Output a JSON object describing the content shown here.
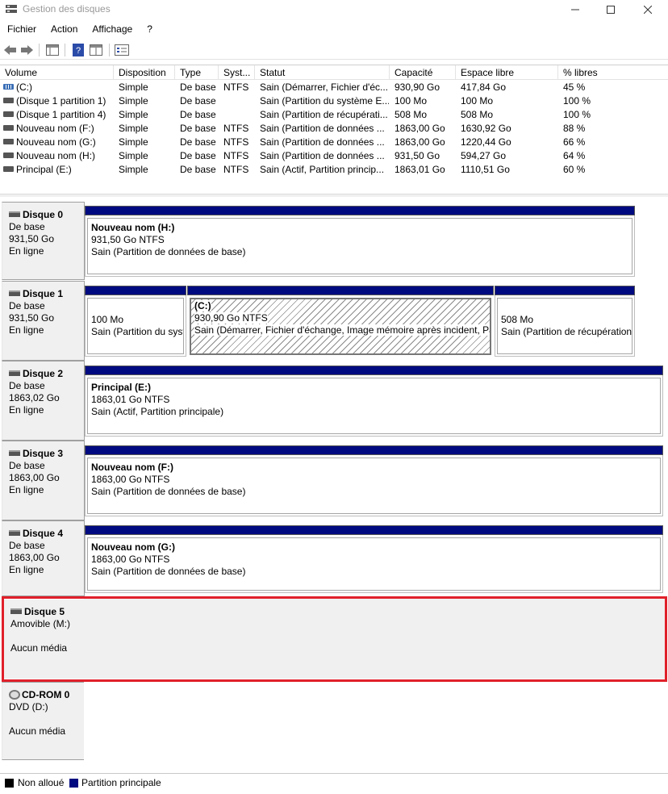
{
  "window": {
    "title": "Gestion des disques"
  },
  "menu": [
    "Fichier",
    "Action",
    "Affichage",
    "?"
  ],
  "volume_table": {
    "headers": [
      "Volume",
      "Disposition",
      "Type",
      "Syst...",
      "Statut",
      "Capacité",
      "Espace libre",
      "% libres"
    ],
    "rows": [
      {
        "volume": "(C:)",
        "disposition": "Simple",
        "type": "De base",
        "fs": "NTFS",
        "statut": "Sain (Démarrer, Fichier d'éc...",
        "capacite": "930,90 Go",
        "libre": "417,84 Go",
        "pct": "45 %",
        "icon": "system-volume-icon"
      },
      {
        "volume": "(Disque 1 partition 1)",
        "disposition": "Simple",
        "type": "De base",
        "fs": "",
        "statut": "Sain (Partition du système E...",
        "capacite": "100 Mo",
        "libre": "100 Mo",
        "pct": "100 %",
        "icon": "volume-icon"
      },
      {
        "volume": "(Disque 1 partition 4)",
        "disposition": "Simple",
        "type": "De base",
        "fs": "",
        "statut": "Sain (Partition de récupérati...",
        "capacite": "508 Mo",
        "libre": "508 Mo",
        "pct": "100 %",
        "icon": "volume-icon"
      },
      {
        "volume": "Nouveau nom (F:)",
        "disposition": "Simple",
        "type": "De base",
        "fs": "NTFS",
        "statut": "Sain (Partition de données ...",
        "capacite": "1863,00 Go",
        "libre": "1630,92 Go",
        "pct": "88 %",
        "icon": "volume-icon"
      },
      {
        "volume": "Nouveau nom (G:)",
        "disposition": "Simple",
        "type": "De base",
        "fs": "NTFS",
        "statut": "Sain (Partition de données ...",
        "capacite": "1863,00 Go",
        "libre": "1220,44 Go",
        "pct": "66 %",
        "icon": "volume-icon"
      },
      {
        "volume": "Nouveau nom (H:)",
        "disposition": "Simple",
        "type": "De base",
        "fs": "NTFS",
        "statut": "Sain (Partition de données ...",
        "capacite": "931,50 Go",
        "libre": "594,27 Go",
        "pct": "64 %",
        "icon": "volume-icon"
      },
      {
        "volume": "Principal (E:)",
        "disposition": "Simple",
        "type": "De base",
        "fs": "NTFS",
        "statut": "Sain (Actif, Partition princip...",
        "capacite": "1863,01 Go",
        "libre": "1110,51 Go",
        "pct": "60 %",
        "icon": "volume-icon"
      }
    ]
  },
  "disks": [
    {
      "name": "Disque 0",
      "kind": "De base",
      "size": "931,50 Go",
      "state": "En ligne",
      "partitions": [
        {
          "name": "Nouveau nom  (H:)",
          "size": "931,50 Go NTFS",
          "status": "Sain (Partition de données de base)"
        }
      ]
    },
    {
      "name": "Disque 1",
      "kind": "De base",
      "size": "931,50 Go",
      "state": "En ligne",
      "partitions": [
        {
          "name": "",
          "size": "100 Mo",
          "status": "Sain (Partition du système EFI)"
        },
        {
          "name": "(C:)",
          "size": "930,90 Go NTFS",
          "status": "Sain (Démarrer, Fichier d'échange, Image mémoire après incident, Partition de données de base)"
        },
        {
          "name": "",
          "size": "508 Mo",
          "status": "Sain (Partition de récupération)"
        }
      ]
    },
    {
      "name": "Disque 2",
      "kind": "De base",
      "size": "1863,02 Go",
      "state": "En ligne",
      "partitions": [
        {
          "name": "Principal  (E:)",
          "size": "1863,01 Go NTFS",
          "status": "Sain (Actif, Partition principale)"
        }
      ]
    },
    {
      "name": "Disque 3",
      "kind": "De base",
      "size": "1863,00 Go",
      "state": "En ligne",
      "partitions": [
        {
          "name": "Nouveau nom  (F:)",
          "size": "1863,00 Go NTFS",
          "status": "Sain (Partition de données de base)"
        }
      ]
    },
    {
      "name": "Disque 4",
      "kind": "De base",
      "size": "1863,00 Go",
      "state": "En ligne",
      "partitions": [
        {
          "name": "Nouveau nom  (G:)",
          "size": "1863,00 Go NTFS",
          "status": "Sain (Partition de données de base)"
        }
      ]
    },
    {
      "name": "Disque 5",
      "kind": "Amovible (M:)",
      "size": "",
      "state": "Aucun média",
      "partitions": []
    },
    {
      "name": "CD-ROM 0",
      "kind": "DVD (D:)",
      "size": "",
      "state": "Aucun média",
      "partitions": []
    }
  ],
  "legend": [
    "Non alloué",
    "Partition principale"
  ],
  "colors": {
    "primary_partition": "#000a80",
    "unallocated": "#000000",
    "selection": "#e0202a"
  }
}
